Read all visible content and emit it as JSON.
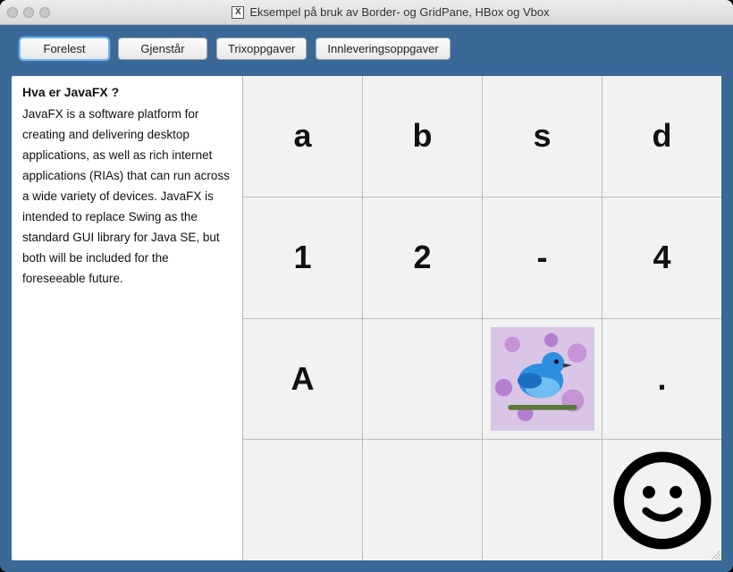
{
  "window": {
    "title": "Eksempel på bruk av Border- og GridPane, HBox og Vbox"
  },
  "toolbar": {
    "buttons": [
      {
        "label": "Forelest",
        "focused": true
      },
      {
        "label": "Gjenstår",
        "focused": false
      },
      {
        "label": "Trixoppgaver",
        "focused": false
      },
      {
        "label": "Innleveringsoppgaver",
        "focused": false
      }
    ]
  },
  "sidebar": {
    "heading": "Hva er JavaFX ?",
    "body": "JavaFX is a software platform for creating and delivering desktop applications, as well as rich internet applications (RIAs) that can run across a wide variety of devices. JavaFX is intended to replace Swing as the standard GUI library for Java SE, but both will be included for the foreseeable future."
  },
  "grid": {
    "cells": [
      [
        "text",
        "a"
      ],
      [
        "text",
        "b"
      ],
      [
        "text",
        "s"
      ],
      [
        "text",
        "d"
      ],
      [
        "text",
        "1"
      ],
      [
        "text",
        "2"
      ],
      [
        "text",
        "-"
      ],
      [
        "text",
        "4"
      ],
      [
        "text",
        "A"
      ],
      [
        "text",
        ""
      ],
      [
        "image",
        "bird-in-flowers"
      ],
      [
        "text",
        "."
      ],
      [
        "text",
        ""
      ],
      [
        "text",
        ""
      ],
      [
        "text",
        ""
      ],
      [
        "icon",
        "smiley"
      ]
    ]
  }
}
